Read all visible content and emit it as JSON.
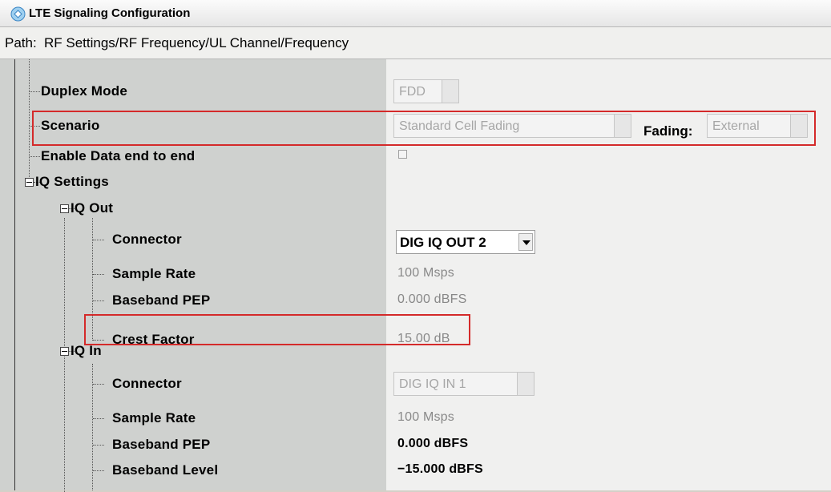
{
  "window": {
    "title": "LTE Signaling Configuration",
    "icon": "lte-signaling-icon"
  },
  "path": {
    "label": "Path:",
    "value": "RF Settings/RF Frequency/UL Channel/Frequency"
  },
  "rows": {
    "duplex_mode": {
      "label": "Duplex Mode",
      "value": "FDD"
    },
    "scenario": {
      "label": "Scenario",
      "value": "Standard Cell Fading",
      "fading_label": "Fading:",
      "fading_value": "External"
    },
    "enable_data": {
      "label": "Enable Data end to end",
      "checked": false
    },
    "iq_settings": {
      "label": "IQ Settings",
      "expanded": true
    },
    "iq_out": {
      "label": "IQ Out",
      "expanded": true,
      "connector": {
        "label": "Connector",
        "value": "DIG IQ OUT 2"
      },
      "sample_rate": {
        "label": "Sample Rate",
        "value": "100 Msps"
      },
      "baseband_pep": {
        "label": "Baseband PEP",
        "value": "0.000 dBFS"
      },
      "crest_factor": {
        "label": "Crest Factor",
        "value": "15.00 dB"
      }
    },
    "iq_in": {
      "label": "IQ In",
      "expanded": true,
      "connector": {
        "label": "Connector",
        "value": "DIG IQ IN 1"
      },
      "sample_rate": {
        "label": "Sample Rate",
        "value": "100 Msps"
      },
      "baseband_pep": {
        "label": "Baseband PEP",
        "value": "0.000 dBFS"
      },
      "baseband_level": {
        "label": "Baseband Level",
        "value": "−15.000 dBFS"
      }
    }
  },
  "colors": {
    "highlight": "#d42a2a",
    "tree_background": "#cfd1cf",
    "value_background": "#f0f0ef"
  }
}
